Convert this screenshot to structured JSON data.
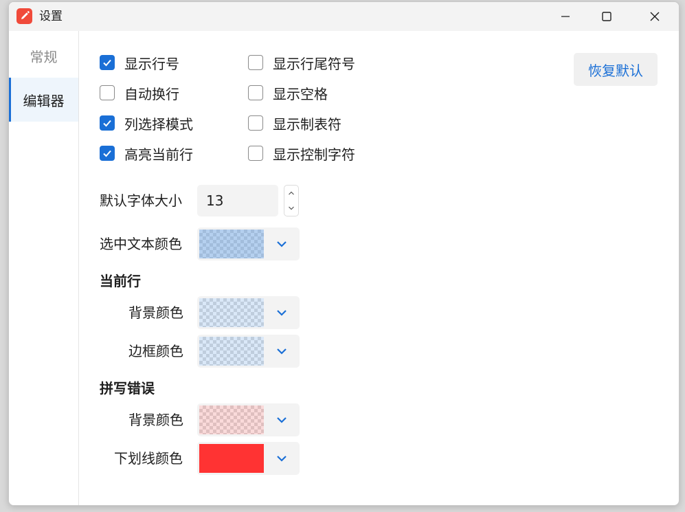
{
  "window": {
    "title": "设置",
    "icon": "pencil-app-icon",
    "controls": [
      "minimize-icon",
      "maximize-icon",
      "close-icon"
    ]
  },
  "sidebar": {
    "items": [
      {
        "label": "常规",
        "active": false
      },
      {
        "label": "编辑器",
        "active": true
      }
    ]
  },
  "editor": {
    "checkboxes_left": [
      {
        "label": "显示行号",
        "checked": true
      },
      {
        "label": "自动换行",
        "checked": false
      },
      {
        "label": "列选择模式",
        "checked": true
      },
      {
        "label": "高亮当前行",
        "checked": true
      }
    ],
    "checkboxes_right": [
      {
        "label": "显示行尾符号",
        "checked": false
      },
      {
        "label": "显示空格",
        "checked": false
      },
      {
        "label": "显示制表符",
        "checked": false
      },
      {
        "label": "显示控制字符",
        "checked": false
      }
    ],
    "restore_label": "恢复默认",
    "font_size": {
      "label": "默认字体大小",
      "value": "13"
    },
    "selection_color": {
      "label": "选中文本颜色",
      "color": "rgba(120,170,225,0.55)"
    },
    "current_line": {
      "heading": "当前行",
      "background": {
        "label": "背景颜色",
        "color": "rgba(150,190,235,0.35)"
      },
      "border": {
        "label": "边框颜色",
        "color": "rgba(150,190,235,0.35)"
      }
    },
    "spelling": {
      "heading": "拼写错误",
      "background": {
        "label": "背景颜色",
        "color": "rgba(240,150,150,0.35)"
      },
      "underline": {
        "label": "下划线颜色",
        "color": "#ff3333"
      }
    }
  },
  "colors": {
    "accent": "#1a6fd6",
    "app_icon": "#f04a3a"
  }
}
